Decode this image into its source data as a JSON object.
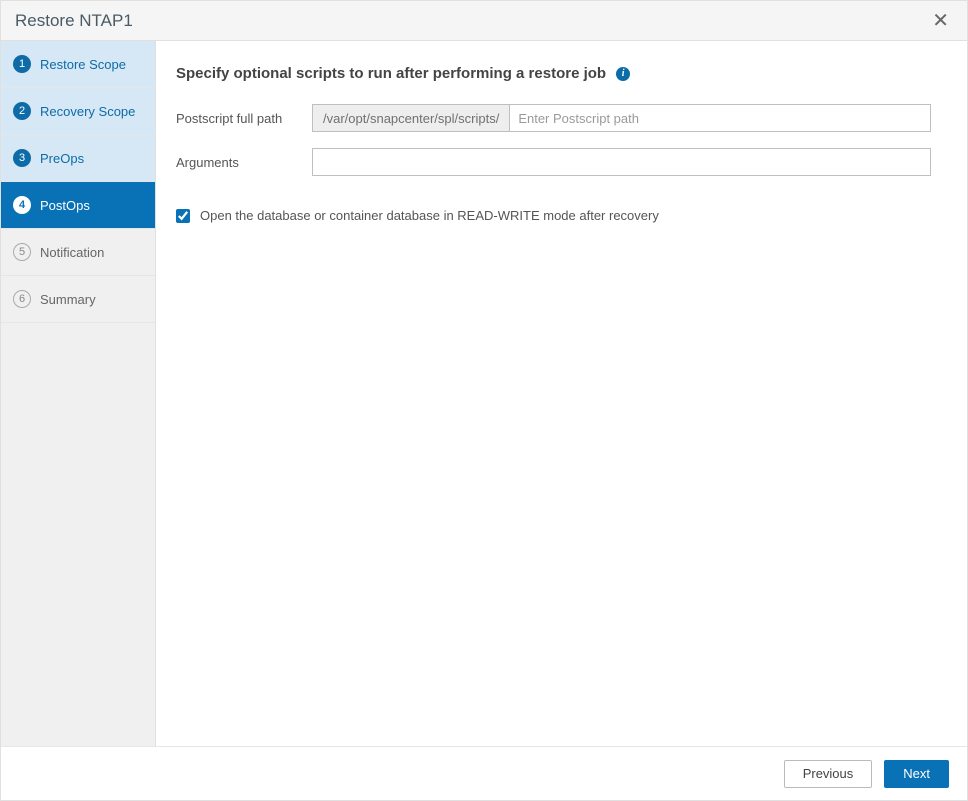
{
  "header": {
    "title": "Restore NTAP1"
  },
  "sidebar": {
    "steps": [
      {
        "num": "1",
        "label": "Restore Scope",
        "state": "completed"
      },
      {
        "num": "2",
        "label": "Recovery Scope",
        "state": "completed"
      },
      {
        "num": "3",
        "label": "PreOps",
        "state": "completed"
      },
      {
        "num": "4",
        "label": "PostOps",
        "state": "active"
      },
      {
        "num": "5",
        "label": "Notification",
        "state": "upcoming"
      },
      {
        "num": "6",
        "label": "Summary",
        "state": "upcoming"
      }
    ]
  },
  "main": {
    "title": "Specify optional scripts to run after performing a restore job",
    "postscript_label": "Postscript full path",
    "postscript_prefix": "/var/opt/snapcenter/spl/scripts/",
    "postscript_placeholder": "Enter Postscript path",
    "postscript_value": "",
    "arguments_label": "Arguments",
    "arguments_value": "",
    "checkbox_label": "Open the database or container database in READ-WRITE mode after recovery",
    "checkbox_checked": true
  },
  "footer": {
    "previous": "Previous",
    "next": "Next"
  }
}
